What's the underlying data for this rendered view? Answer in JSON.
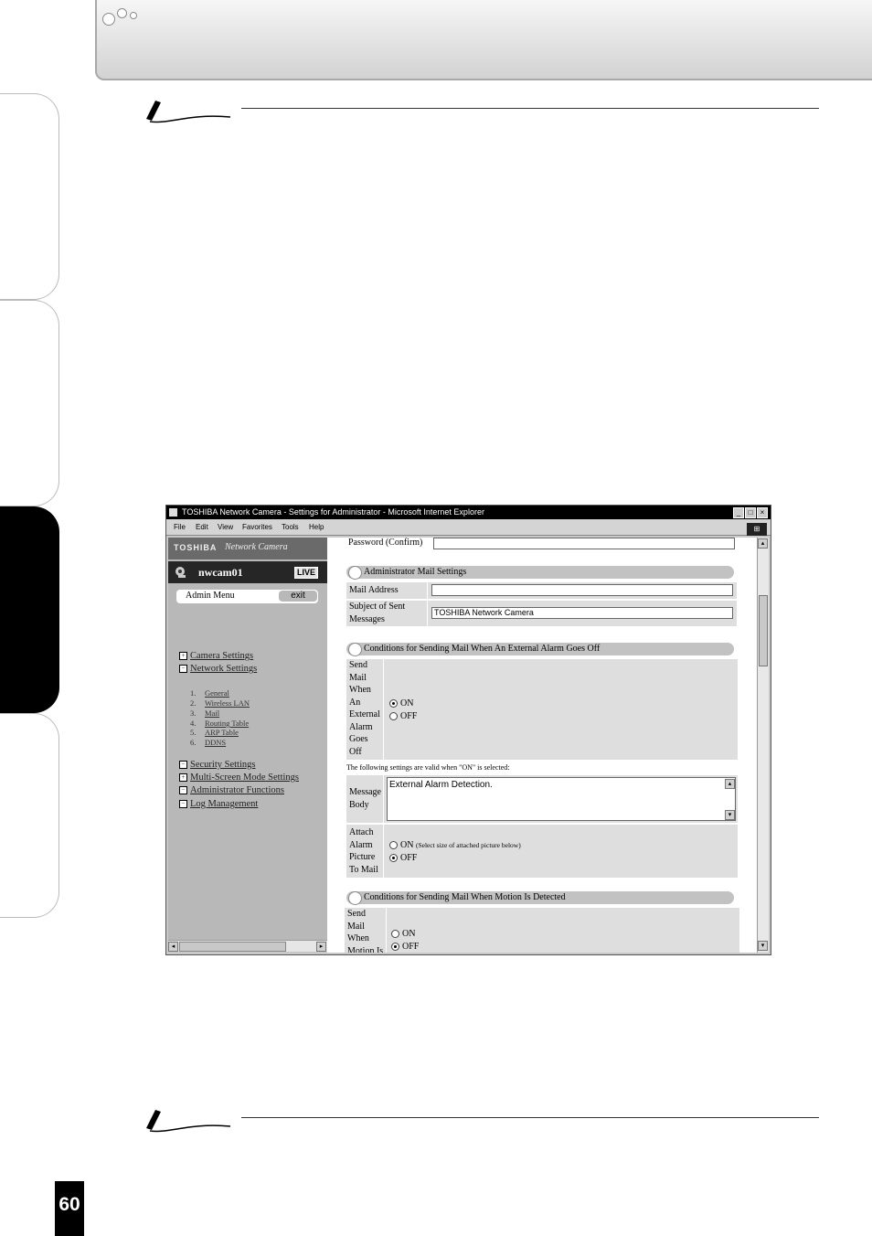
{
  "page": {
    "number": "60"
  },
  "browser": {
    "title": "TOSHIBA Network Camera - Settings for Administrator - Microsoft Internet Explorer",
    "menu": [
      "File",
      "Edit",
      "View",
      "Favorites",
      "Tools",
      "Help"
    ],
    "window_buttons": [
      "_",
      "□",
      "×"
    ]
  },
  "sidebar": {
    "brand": "TOSHIBA",
    "product": "Network Camera",
    "camera_name": "nwcam01",
    "live_label": "LIVE",
    "admin_menu_label": "Admin Menu",
    "exit_label": "exit",
    "sections_top": [
      {
        "label": "Camera Settings",
        "toggle": "+"
      },
      {
        "label": "Network Settings",
        "toggle": "−"
      }
    ],
    "network_subitems": [
      {
        "num": "1.",
        "label": "General"
      },
      {
        "num": "2.",
        "label": "Wireless LAN"
      },
      {
        "num": "3.",
        "label": "Mail"
      },
      {
        "num": "4.",
        "label": "Routing Table"
      },
      {
        "num": "5.",
        "label": "ARP Table"
      },
      {
        "num": "6.",
        "label": "DDNS"
      }
    ],
    "sections_bottom": [
      {
        "label": "Security Settings",
        "toggle": "−"
      },
      {
        "label": "Multi-Screen Mode Settings",
        "toggle": "+"
      },
      {
        "label": "Administrator Functions",
        "toggle": "−"
      },
      {
        "label": "Log Management",
        "toggle": "−"
      }
    ]
  },
  "main": {
    "password_confirm_label": "Password (Confirm)",
    "admin_mail": {
      "title": "Administrator Mail Settings",
      "mail_address_label": "Mail Address",
      "mail_address_value": "",
      "subject_label_1": "Subject of Sent",
      "subject_label_2": "Messages",
      "subject_value": "TOSHIBA Network Camera"
    },
    "alarm": {
      "title": "Conditions for Sending Mail When An External Alarm Goes Off",
      "send_label_lines": [
        "Send",
        "Mail",
        "When",
        "An",
        "External",
        "Alarm",
        "Goes",
        "Off"
      ],
      "on_label": "ON",
      "off_label": "OFF",
      "selected": "ON",
      "valid_note": "The following settings are valid when \"ON\" is selected:",
      "message_label_lines": [
        "Message",
        "Body"
      ],
      "message_body": "External Alarm Detection.",
      "attach_label_lines": [
        "Attach",
        "Alarm",
        "Picture",
        "To Mail"
      ],
      "attach_on_label": "ON",
      "attach_on_note": "(Select size of attached picture below)",
      "attach_off_label": "OFF",
      "attach_selected": "OFF"
    },
    "motion": {
      "title": "Conditions for Sending Mail When Motion Is Detected",
      "send_label_lines": [
        "Send",
        "Mail",
        "When",
        "Motion Is"
      ],
      "on_label": "ON",
      "off_label": "OFF",
      "selected": "OFF"
    }
  }
}
